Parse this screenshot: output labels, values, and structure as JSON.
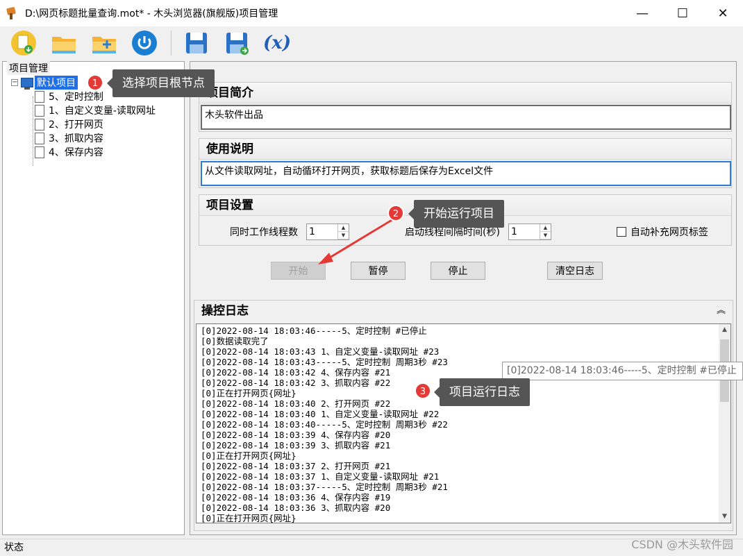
{
  "window": {
    "title": "D:\\网页标题批量查询.mot* - 木头浏览器(旗舰版)项目管理",
    "minimize": "—",
    "maximize": "☐",
    "close": "✕"
  },
  "toolbar": {
    "icons": [
      "new-project-icon",
      "open-folder-icon",
      "add-folder-icon",
      "power-icon",
      "save-icon",
      "save-as-icon",
      "variable-icon"
    ],
    "variable_label": "(x)"
  },
  "left_panel": {
    "header": "项目管理",
    "expander": "−",
    "root_label": "默认项目",
    "children": [
      "5、定时控制",
      "1、自定义变量-读取网址",
      "2、打开网页",
      "3、抓取内容",
      "4、保存内容"
    ]
  },
  "intro": {
    "header": "项目简介",
    "value": "木头软件出品"
  },
  "usage": {
    "header": "使用说明",
    "value": "从文件读取网址，自动循环打开网页，获取标题后保存为Excel文件"
  },
  "settings": {
    "header": "项目设置",
    "threads_label": "同时工作线程数",
    "threads_value": "1",
    "interval_label": "启动线程间隔时间(秒)",
    "interval_value": "1",
    "autofill_label": "自动补充网页标签",
    "spin_up": "▲",
    "spin_down": "▼"
  },
  "buttons": {
    "start": "开始",
    "pause": "暂停",
    "stop": "停止",
    "clear_log": "清空日志"
  },
  "log": {
    "header": "操控日志",
    "collapse": "︽",
    "scroll_up": "▲",
    "scroll_down": "▼",
    "lines": [
      "[0]2022-08-14 18:03:46-----5、定时控制 #已停止",
      "[0]数据读取完了",
      "[0]2022-08-14 18:03:43 1、自定义变量-读取网址 #23",
      "[0]2022-08-14 18:03:43-----5、定时控制 周期3秒 #23",
      "[0]2022-08-14 18:03:42 4、保存内容 #21",
      "[0]2022-08-14 18:03:42 3、抓取内容 #22",
      "[0]正在打开网页{网址}",
      "[0]2022-08-14 18:03:40 2、打开网页 #22",
      "[0]2022-08-14 18:03:40 1、自定义变量-读取网址 #22",
      "[0]2022-08-14 18:03:40-----5、定时控制 周期3秒 #22",
      "[0]2022-08-14 18:03:39 4、保存内容 #20",
      "[0]2022-08-14 18:03:39 3、抓取内容 #21",
      "[0]正在打开网页{网址}",
      "[0]2022-08-14 18:03:37 2、打开网页 #21",
      "[0]2022-08-14 18:03:37 1、自定义变量-读取网址 #21",
      "[0]2022-08-14 18:03:37-----5、定时控制 周期3秒 #21",
      "[0]2022-08-14 18:03:36 4、保存内容 #19",
      "[0]2022-08-14 18:03:36 3、抓取内容 #20",
      "[0]正在打开网页{网址}"
    ],
    "tooltip": "[0]2022-08-14 18:03:46-----5、定时控制 #已停止"
  },
  "annotations": {
    "badge1": "1",
    "callout1": "选择项目根节点",
    "badge2": "2",
    "callout2": "开始运行项目",
    "badge3": "3",
    "callout3": "项目运行日志"
  },
  "status": {
    "label": "状态"
  },
  "watermark": "CSDN @木头软件园"
}
